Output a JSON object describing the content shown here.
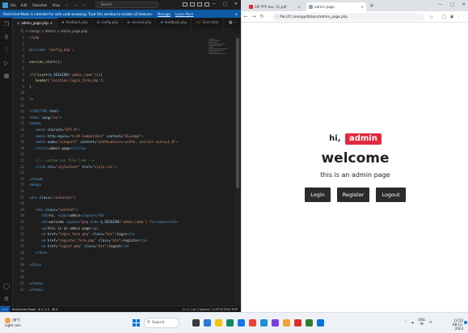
{
  "vscode": {
    "menu": [
      "File",
      "Edit",
      "Selection",
      "View",
      "···"
    ],
    "nav_arrows": "← →",
    "search_placeholder": "Search",
    "banner": {
      "text": "Restricted Mode is intended for safe code browsing. Trust this window to enable all features.",
      "manage_label": "Manage",
      "learn_more_label": "Learn More"
    },
    "tabs": [
      {
        "label": "admin_page.php",
        "active": true
      },
      {
        "label": "feedback.php",
        "active": false
      },
      {
        "label": "config.php",
        "active": false
      },
      {
        "label": "connect.php",
        "active": false
      },
      {
        "label": "feedback.php",
        "active": false
      },
      {
        "label": "form.html",
        "active": false
      }
    ],
    "breadcrumb": "C: > xampp > htdocs > admin_page.php",
    "status": {
      "remote": "←→",
      "restricted": "Restricted Mode",
      "problems": "⊗ 0 ⚠ 0",
      "ports": "⌘ 0",
      "right": "Ln 1, Col 1   Spaces: 2   UTF-8   CRLF   PHP"
    }
  },
  "code_lines": [
    {
      "n": 1,
      "parts": [
        {
          "t": "<?php",
          "c": "php"
        }
      ]
    },
    {
      "n": 2,
      "parts": []
    },
    {
      "n": 3,
      "parts": [
        {
          "t": "@include ",
          "c": "kw"
        },
        {
          "t": "'config.php'",
          "c": "str"
        },
        {
          "t": ";",
          "c": "dflt"
        }
      ]
    },
    {
      "n": 4,
      "parts": []
    },
    {
      "n": 5,
      "parts": [
        {
          "t": "session_start",
          "c": "fn"
        },
        {
          "t": "();",
          "c": "dflt"
        }
      ]
    },
    {
      "n": 6,
      "parts": []
    },
    {
      "n": 7,
      "parts": [
        {
          "t": "if",
          "c": "php"
        },
        {
          "t": "(!",
          "c": "dflt"
        },
        {
          "t": "isset",
          "c": "fn"
        },
        {
          "t": "(",
          "c": "dflt"
        },
        {
          "t": "$_SESSION",
          "c": "var"
        },
        {
          "t": "['admin_name']",
          "c": "str"
        },
        {
          "t": ")){",
          "c": "dflt"
        }
      ]
    },
    {
      "n": 8,
      "parts": [
        {
          "t": "   header",
          "c": "fn"
        },
        {
          "t": "(",
          "c": "dflt"
        },
        {
          "t": "'location:login_form.php'",
          "c": "str"
        },
        {
          "t": ");",
          "c": "dflt"
        }
      ]
    },
    {
      "n": 9,
      "parts": [
        {
          "t": "}",
          "c": "dflt"
        }
      ]
    },
    {
      "n": 10,
      "parts": []
    },
    {
      "n": 11,
      "parts": [
        {
          "t": "?>",
          "c": "php"
        }
      ]
    },
    {
      "n": 12,
      "parts": []
    },
    {
      "n": 13,
      "parts": [
        {
          "t": "<!DOCTYPE ",
          "c": "tag"
        },
        {
          "t": "html",
          "c": "attr"
        },
        {
          "t": ">",
          "c": "tag"
        }
      ]
    },
    {
      "n": 14,
      "parts": [
        {
          "t": "<html ",
          "c": "tag"
        },
        {
          "t": "lang",
          "c": "attr"
        },
        {
          "t": "=",
          "c": "dflt"
        },
        {
          "t": "\"en\"",
          "c": "str"
        },
        {
          "t": ">",
          "c": "tag"
        }
      ]
    },
    {
      "n": 15,
      "parts": [
        {
          "t": "<head>",
          "c": "tag"
        }
      ]
    },
    {
      "n": 16,
      "parts": [
        {
          "t": "   <meta ",
          "c": "tag"
        },
        {
          "t": "charset",
          "c": "attr"
        },
        {
          "t": "=",
          "c": "dflt"
        },
        {
          "t": "\"UTF-8\"",
          "c": "str"
        },
        {
          "t": ">",
          "c": "tag"
        }
      ]
    },
    {
      "n": 17,
      "parts": [
        {
          "t": "   <meta ",
          "c": "tag"
        },
        {
          "t": "http-equiv",
          "c": "attr"
        },
        {
          "t": "=",
          "c": "dflt"
        },
        {
          "t": "\"X-UA-Compatible\" ",
          "c": "str"
        },
        {
          "t": "content",
          "c": "attr"
        },
        {
          "t": "=",
          "c": "dflt"
        },
        {
          "t": "\"IE=edge\"",
          "c": "str"
        },
        {
          "t": ">",
          "c": "tag"
        }
      ]
    },
    {
      "n": 18,
      "parts": [
        {
          "t": "   <meta ",
          "c": "tag"
        },
        {
          "t": "name",
          "c": "attr"
        },
        {
          "t": "=",
          "c": "dflt"
        },
        {
          "t": "\"viewport\" ",
          "c": "str"
        },
        {
          "t": "content",
          "c": "attr"
        },
        {
          "t": "=",
          "c": "dflt"
        },
        {
          "t": "\"width=device-width, initial-scale=1.0\"",
          "c": "str"
        },
        {
          "t": ">",
          "c": "tag"
        }
      ]
    },
    {
      "n": 19,
      "parts": [
        {
          "t": "   <title>",
          "c": "tag"
        },
        {
          "t": "admin page",
          "c": "txt"
        },
        {
          "t": "</title>",
          "c": "tag"
        }
      ]
    },
    {
      "n": 20,
      "parts": []
    },
    {
      "n": 21,
      "parts": [
        {
          "t": "   <!-- custom css file link -->",
          "c": "com"
        }
      ]
    },
    {
      "n": 22,
      "parts": [
        {
          "t": "   <link ",
          "c": "tag"
        },
        {
          "t": "rel",
          "c": "attr"
        },
        {
          "t": "=",
          "c": "dflt"
        },
        {
          "t": "\"stylesheet\" ",
          "c": "str"
        },
        {
          "t": "href",
          "c": "attr"
        },
        {
          "t": "=",
          "c": "dflt"
        },
        {
          "t": "\"style.css\"",
          "c": "str"
        },
        {
          "t": ">",
          "c": "tag"
        }
      ]
    },
    {
      "n": 23,
      "parts": []
    },
    {
      "n": 24,
      "parts": [
        {
          "t": "</head>",
          "c": "tag"
        }
      ]
    },
    {
      "n": 25,
      "parts": [
        {
          "t": "<body>",
          "c": "tag"
        }
      ]
    },
    {
      "n": 26,
      "parts": []
    },
    {
      "n": 27,
      "parts": [
        {
          "t": "<div ",
          "c": "tag"
        },
        {
          "t": "class",
          "c": "attr"
        },
        {
          "t": "=",
          "c": "dflt"
        },
        {
          "t": "\"container\"",
          "c": "str"
        },
        {
          "t": ">",
          "c": "tag"
        }
      ]
    },
    {
      "n": 28,
      "parts": []
    },
    {
      "n": 29,
      "parts": [
        {
          "t": "   <div ",
          "c": "tag"
        },
        {
          "t": "class",
          "c": "attr"
        },
        {
          "t": "=",
          "c": "dflt"
        },
        {
          "t": "\"content\"",
          "c": "str"
        },
        {
          "t": ">",
          "c": "tag"
        }
      ]
    },
    {
      "n": 30,
      "parts": [
        {
          "t": "      <h3>",
          "c": "tag"
        },
        {
          "t": "hi, ",
          "c": "txt"
        },
        {
          "t": "<span>",
          "c": "tag"
        },
        {
          "t": "admin",
          "c": "txt"
        },
        {
          "t": "</span></h3>",
          "c": "tag"
        }
      ]
    },
    {
      "n": 31,
      "parts": [
        {
          "t": "      <h1>",
          "c": "tag"
        },
        {
          "t": "welcome ",
          "c": "txt"
        },
        {
          "t": "<span>",
          "c": "tag"
        },
        {
          "t": "<?php ",
          "c": "php"
        },
        {
          "t": "echo ",
          "c": "kw"
        },
        {
          "t": "$_SESSION",
          "c": "var"
        },
        {
          "t": "['admin_name']",
          "c": "str"
        },
        {
          "t": " ?>",
          "c": "php"
        },
        {
          "t": "</span></h1>",
          "c": "tag"
        }
      ]
    },
    {
      "n": 32,
      "parts": [
        {
          "t": "      <p>",
          "c": "tag"
        },
        {
          "t": "this is an admin page",
          "c": "txt"
        },
        {
          "t": "</p>",
          "c": "tag"
        }
      ]
    },
    {
      "n": 33,
      "parts": [
        {
          "t": "      <a ",
          "c": "tag"
        },
        {
          "t": "href",
          "c": "attr"
        },
        {
          "t": "=",
          "c": "dflt"
        },
        {
          "t": "\"login_form.php\" ",
          "c": "str"
        },
        {
          "t": "class",
          "c": "attr"
        },
        {
          "t": "=",
          "c": "dflt"
        },
        {
          "t": "\"btn\"",
          "c": "str"
        },
        {
          "t": ">",
          "c": "tag"
        },
        {
          "t": "login",
          "c": "txt"
        },
        {
          "t": "</a>",
          "c": "tag"
        }
      ]
    },
    {
      "n": 34,
      "parts": [
        {
          "t": "      <a ",
          "c": "tag"
        },
        {
          "t": "href",
          "c": "attr"
        },
        {
          "t": "=",
          "c": "dflt"
        },
        {
          "t": "\"register_form.php\" ",
          "c": "str"
        },
        {
          "t": "class",
          "c": "attr"
        },
        {
          "t": "=",
          "c": "dflt"
        },
        {
          "t": "\"btn\"",
          "c": "str"
        },
        {
          "t": ">",
          "c": "tag"
        },
        {
          "t": "register",
          "c": "txt"
        },
        {
          "t": "</a>",
          "c": "tag"
        }
      ]
    },
    {
      "n": 35,
      "parts": [
        {
          "t": "      <a ",
          "c": "tag"
        },
        {
          "t": "href",
          "c": "attr"
        },
        {
          "t": "=",
          "c": "dflt"
        },
        {
          "t": "\"logout.php\" ",
          "c": "str"
        },
        {
          "t": "class",
          "c": "attr"
        },
        {
          "t": "=",
          "c": "dflt"
        },
        {
          "t": "\"btn\"",
          "c": "str"
        },
        {
          "t": ">",
          "c": "tag"
        },
        {
          "t": "logout",
          "c": "txt"
        },
        {
          "t": "</a>",
          "c": "tag"
        }
      ]
    },
    {
      "n": 36,
      "parts": [
        {
          "t": "   </div>",
          "c": "tag"
        }
      ]
    },
    {
      "n": 37,
      "parts": []
    },
    {
      "n": 38,
      "parts": [
        {
          "t": "</div>",
          "c": "tag"
        }
      ]
    },
    {
      "n": 39,
      "parts": []
    },
    {
      "n": 40,
      "parts": []
    },
    {
      "n": 41,
      "parts": [
        {
          "t": "</body>",
          "c": "tag"
        }
      ]
    },
    {
      "n": 42,
      "parts": [
        {
          "t": "</html>",
          "c": "tag"
        }
      ]
    }
  ],
  "browser": {
    "tabs": [
      {
        "label": "SIP PTP doc (1).pdf",
        "fav_color": "#e3283e",
        "active": false
      },
      {
        "label": "admin page",
        "fav_color": "#9aa0a6",
        "active": true
      }
    ],
    "url": "file:///C:/xampp/htdocs/admin_page.php",
    "page": {
      "greeting": "hi,",
      "name": "admin",
      "welcome": "welcome",
      "subtitle": "this is an admin page",
      "buttons": [
        "Login",
        "Register",
        "Logout"
      ]
    }
  },
  "taskbar": {
    "weather_temp": "28°C",
    "weather_desc": "Light rain",
    "search_label": "Search",
    "apps": [
      "#3a3a3a",
      "#2b7bd6",
      "#f4c20d",
      "#0f8a5f",
      "#1a73e8",
      "#ea4335",
      "#1f8fd6",
      "#7b3fe4",
      "#f2a23a",
      "#d93025",
      "#2e7d32",
      "#0a74d6"
    ],
    "lang_top": "ENG",
    "lang_bottom": "IN",
    "time": "13:52",
    "date": "08-11-2023"
  },
  "colors": {
    "accent_red": "#e3283e",
    "vscode_blue": "#0e5aa6",
    "button_dark": "#2b2b2b"
  }
}
